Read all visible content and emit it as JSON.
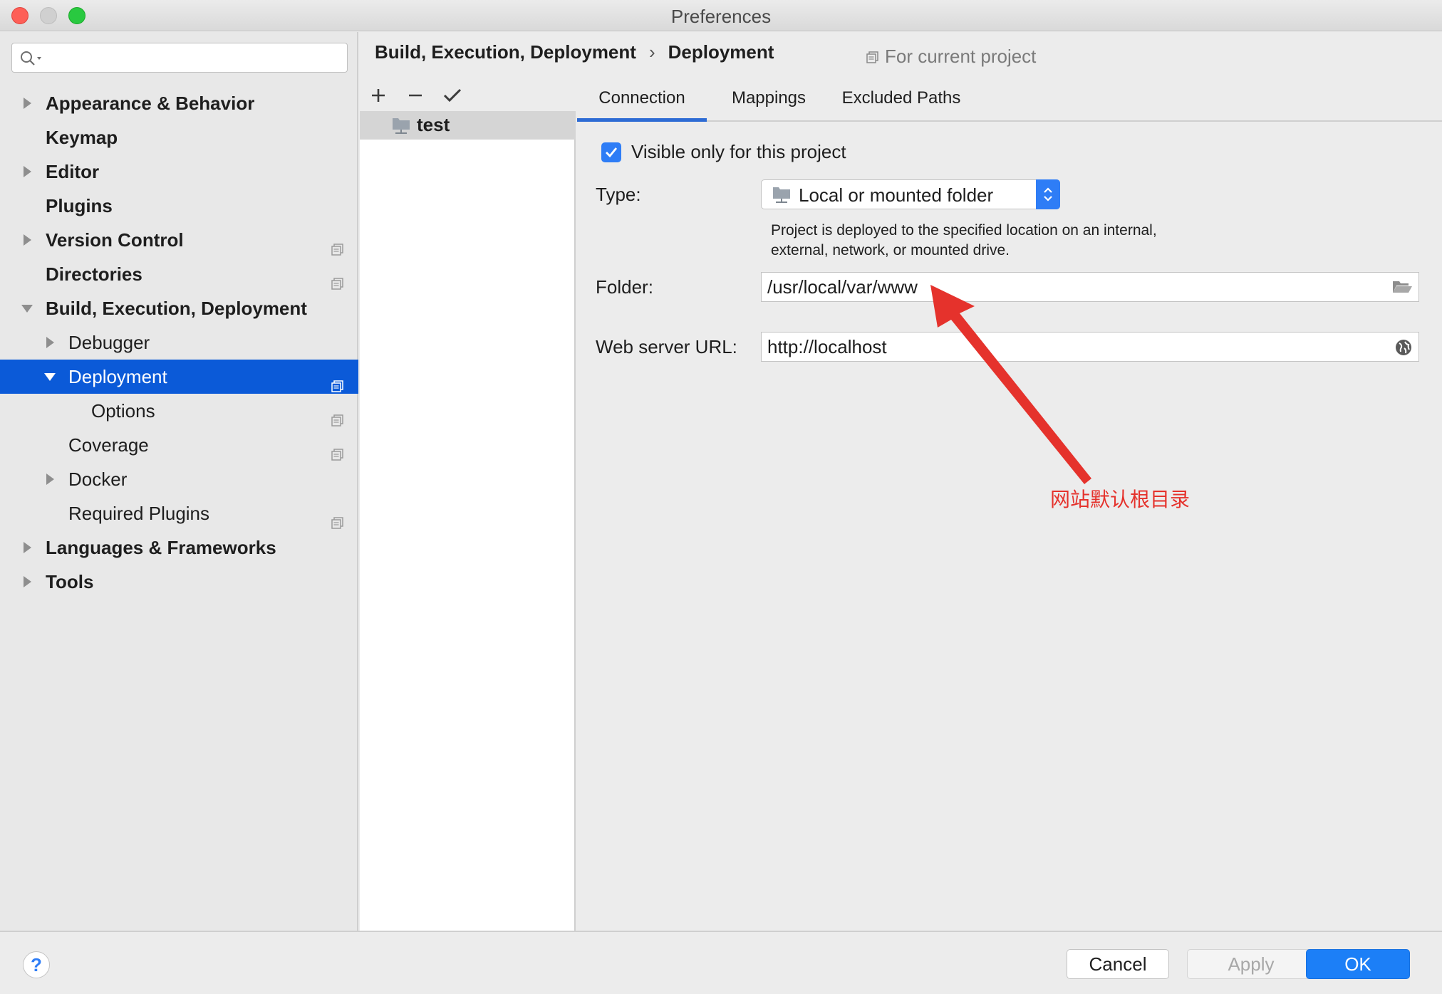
{
  "window": {
    "title": "Preferences"
  },
  "search": {
    "value": "",
    "placeholder": ""
  },
  "sidebar": {
    "items": [
      {
        "label": "Appearance & Behavior",
        "bold": true,
        "arrow": "right",
        "level": 0,
        "project_icon": false
      },
      {
        "label": "Keymap",
        "bold": true,
        "arrow": "none",
        "level": 0,
        "project_icon": false
      },
      {
        "label": "Editor",
        "bold": true,
        "arrow": "right",
        "level": 0,
        "project_icon": false
      },
      {
        "label": "Plugins",
        "bold": true,
        "arrow": "none",
        "level": 0,
        "project_icon": false
      },
      {
        "label": "Version Control",
        "bold": true,
        "arrow": "right",
        "level": 0,
        "project_icon": true
      },
      {
        "label": "Directories",
        "bold": true,
        "arrow": "none",
        "level": 0,
        "project_icon": true
      },
      {
        "label": "Build, Execution, Deployment",
        "bold": true,
        "arrow": "down",
        "level": 0,
        "project_icon": false
      },
      {
        "label": "Debugger",
        "bold": false,
        "arrow": "right",
        "level": 1,
        "project_icon": false
      },
      {
        "label": "Deployment",
        "bold": false,
        "arrow": "down",
        "level": 1,
        "project_icon": true,
        "selected": true
      },
      {
        "label": "Options",
        "bold": false,
        "arrow": "none",
        "level": 2,
        "project_icon": true
      },
      {
        "label": "Coverage",
        "bold": false,
        "arrow": "none",
        "level": 1,
        "project_icon": true
      },
      {
        "label": "Docker",
        "bold": false,
        "arrow": "right",
        "level": 1,
        "project_icon": false
      },
      {
        "label": "Required Plugins",
        "bold": false,
        "arrow": "none",
        "level": 1,
        "project_icon": true
      },
      {
        "label": "Languages & Frameworks",
        "bold": true,
        "arrow": "right",
        "level": 0,
        "project_icon": false
      },
      {
        "label": "Tools",
        "bold": true,
        "arrow": "right",
        "level": 0,
        "project_icon": false
      }
    ]
  },
  "header": {
    "breadcrumb_parent": "Build, Execution, Deployment",
    "breadcrumb_sep": "›",
    "breadcrumb_current": "Deployment",
    "scope_label": "For current project"
  },
  "server_list": {
    "items": [
      {
        "label": "test"
      }
    ]
  },
  "tabs": [
    {
      "label": "Connection",
      "active": true
    },
    {
      "label": "Mappings",
      "active": false
    },
    {
      "label": "Excluded Paths",
      "active": false
    }
  ],
  "form": {
    "visible_only_label": "Visible only for this project",
    "visible_only_checked": true,
    "type_label": "Type:",
    "type_value": "Local or mounted folder",
    "type_description_line1": "Project is deployed to the specified location on an internal,",
    "type_description_line2": "external, network, or mounted drive.",
    "folder_label": "Folder:",
    "folder_value": "/usr/local/var/www",
    "web_url_label": "Web server URL:",
    "web_url_value": "http://localhost"
  },
  "annotation": {
    "text": "网站默认根目录",
    "color": "#e5322c"
  },
  "buttons": {
    "help": "?",
    "cancel": "Cancel",
    "apply": "Apply",
    "ok": "OK"
  },
  "colors": {
    "accent": "#0b5ad8",
    "primary_button": "#1c7ff7"
  }
}
